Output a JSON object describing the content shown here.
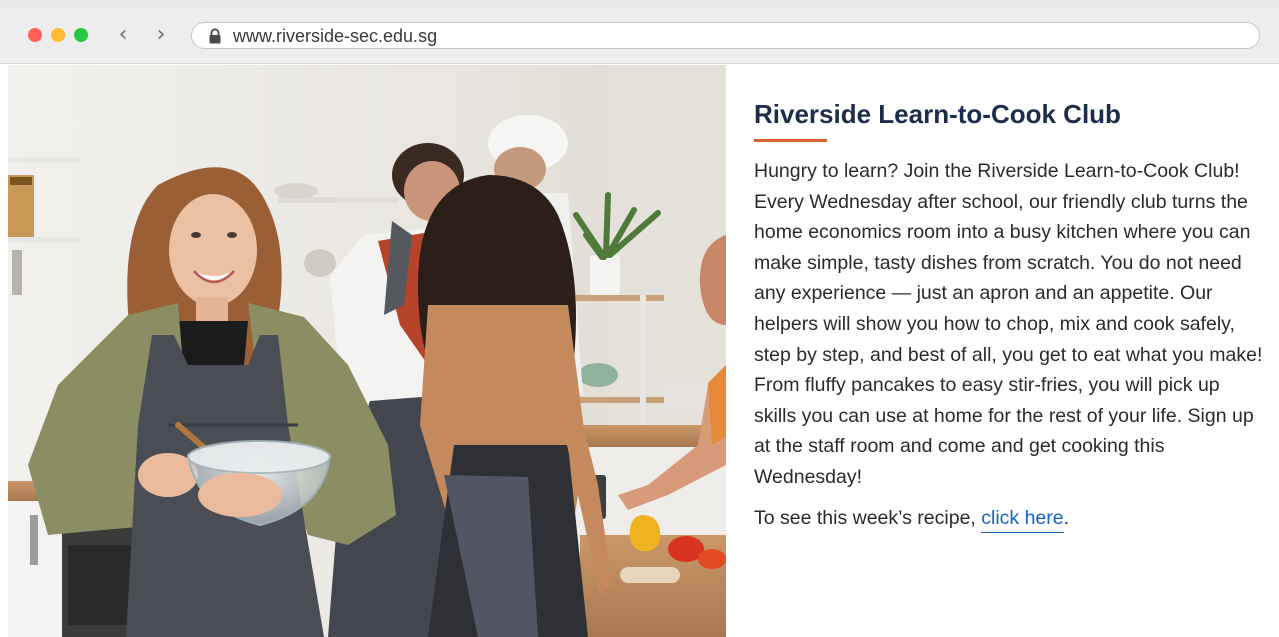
{
  "browser": {
    "url": "www.riverside-sec.edu.sg",
    "back_icon": "chevron-left-icon",
    "forward_icon": "chevron-right-icon",
    "lock_icon": "lock-icon"
  },
  "article": {
    "title": "Riverside Learn-to-Cook Club",
    "accent_color": "#d9622b",
    "title_color": "#1c2d4a",
    "body": "Hungry to learn? Join the Riverside Learn-to-Cook Club! Every Wednesday after school, our friendly club turns the home economics room into a busy kitchen where you can make simple, tasty dishes from scratch. You do not need any experience — just an apron and an appetite. Our helpers will show you how to chop, mix and cook safely, step by step, and best of all, you get to eat what you make! From fluffy pancakes to easy stir-fries, you will pick up skills you can use at home for the rest of your life. Sign up at the staff room and come and get cooking this Wednesday!",
    "recipe_prefix": "To see this week’s recipe, ",
    "recipe_link": "click here",
    "recipe_suffix": ".",
    "link_color": "#1565c0"
  }
}
